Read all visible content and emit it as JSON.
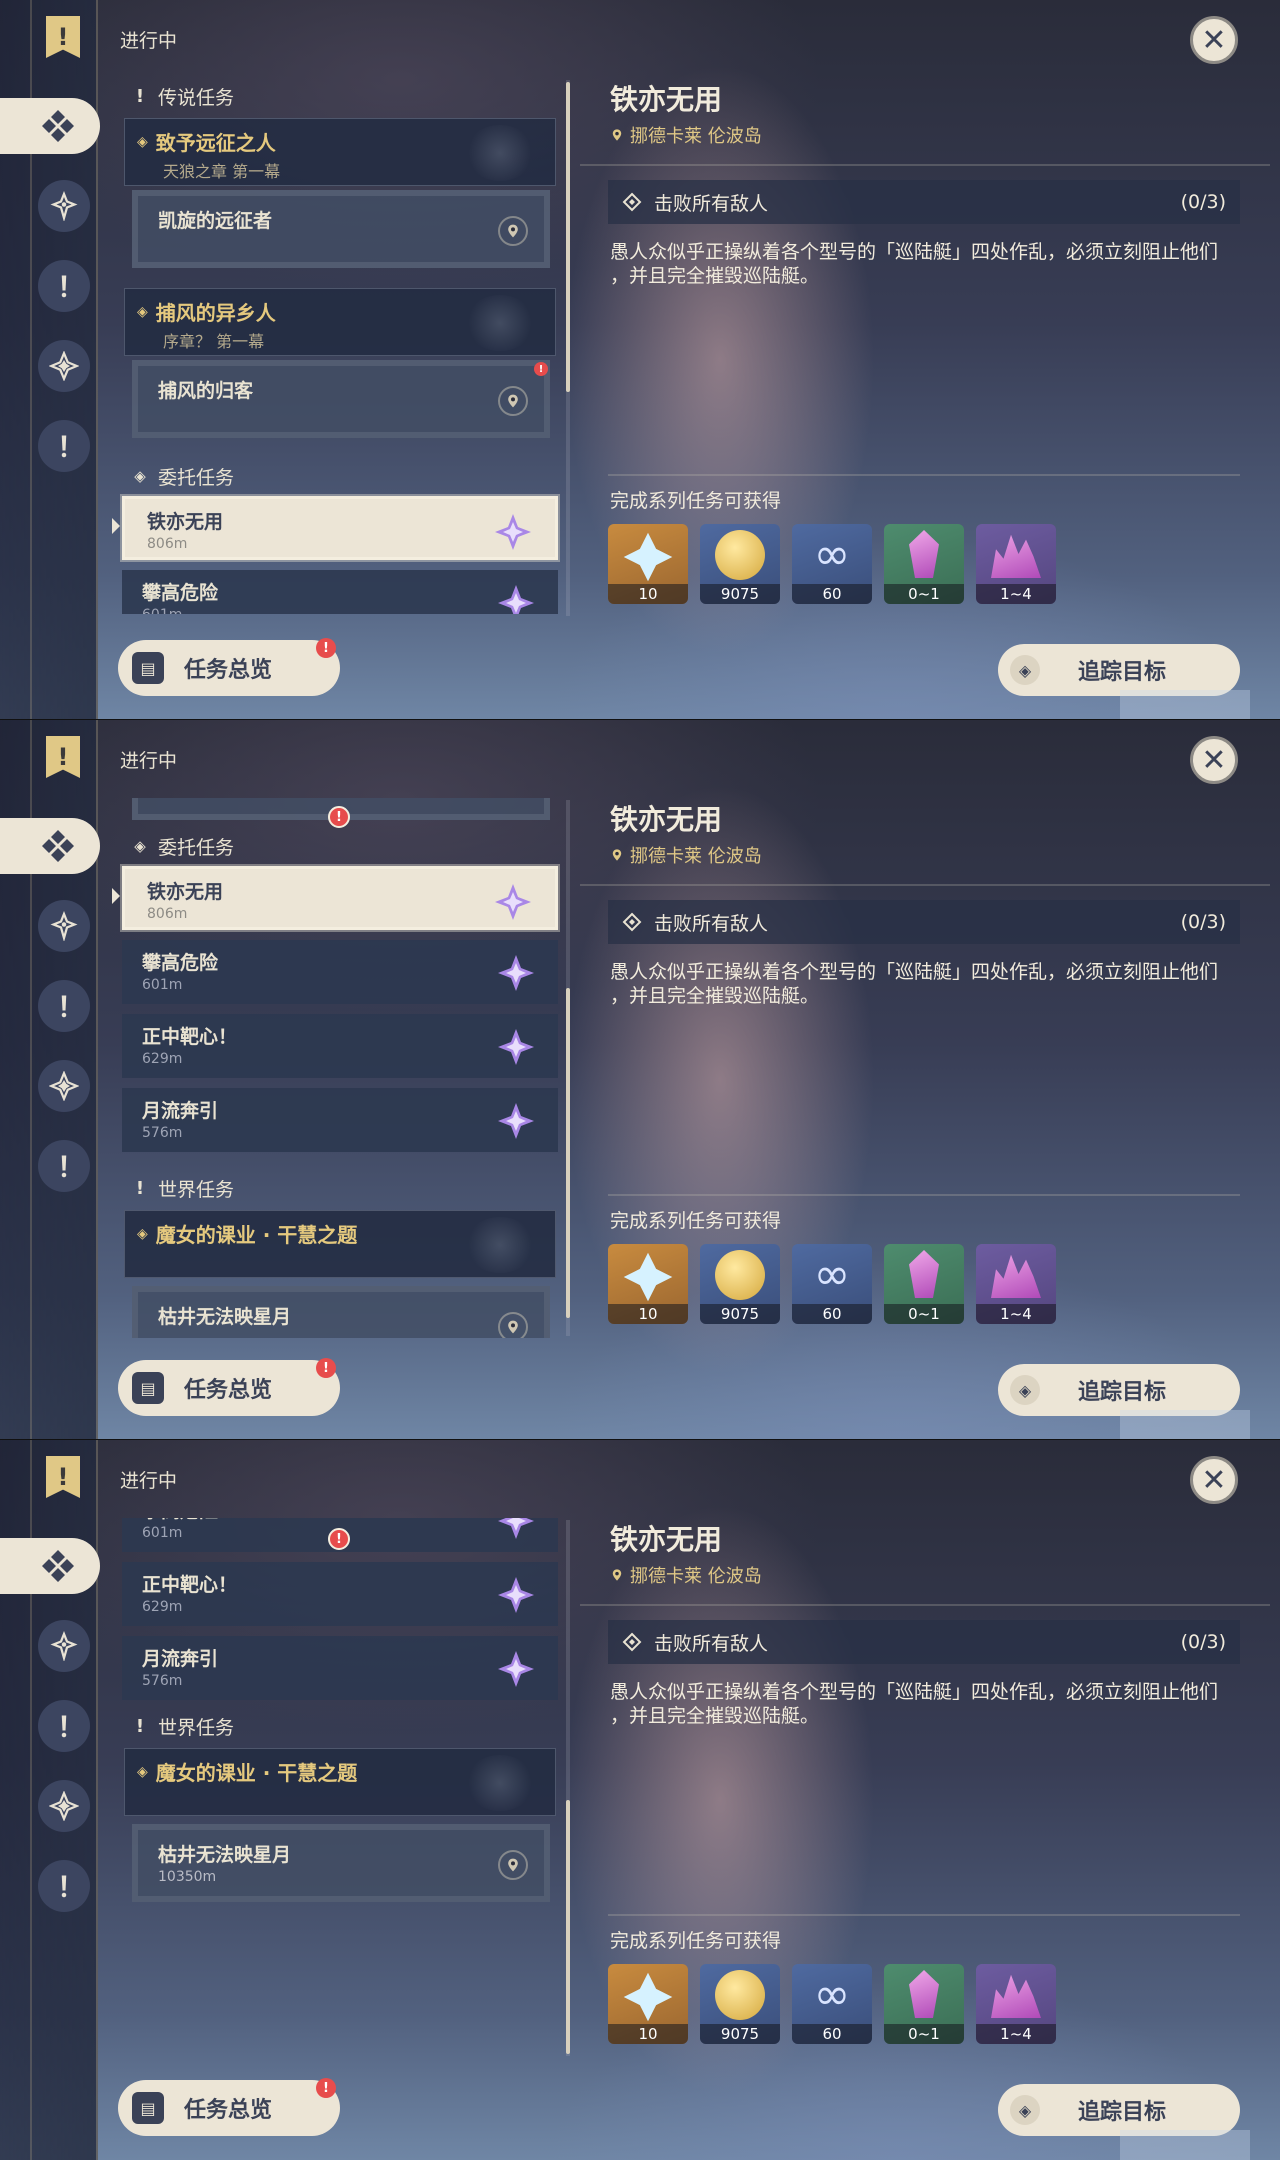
{
  "status_label": "进行中",
  "sections": {
    "legend": "传说任务",
    "commission": "委托任务",
    "world": "世界任务"
  },
  "legend_quests": [
    {
      "title": "致予远征之人",
      "subtitle": "天狼之章 第一幕",
      "subquest": "凯旋的远征者"
    },
    {
      "title": "捕风的异乡人",
      "subtitle": "序章？ 第一幕",
      "subquest": "捕风的归客"
    }
  ],
  "commissions": [
    {
      "name": "铁亦无用",
      "distance": "806m"
    },
    {
      "name": "攀高危险",
      "distance": "601m"
    },
    {
      "name": "正中靶心！",
      "distance": "629m"
    },
    {
      "name": "月流奔引",
      "distance": "576m"
    }
  ],
  "world_quest": {
    "title": "魔女的课业 · 干慧之题",
    "subquest": "枯井无法映星月",
    "distance": "10350m"
  },
  "buttons": {
    "overview": "任务总览",
    "track": "追踪目标",
    "alert_glyph": "!"
  },
  "detail": {
    "title": "铁亦无用",
    "location": "挪德卡莱 伦波岛",
    "objective": "击败所有敌人",
    "progress": "(0/3)",
    "description_line1": "愚人众似乎正操纵着各个型号的「巡陆艇」四处作乱，必须立刻阻止他们",
    "description_line2": "，并且完全摧毁巡陆艇。",
    "rewards_title": "完成系列任务可获得",
    "rewards": [
      {
        "icon": "primogem-icon",
        "count": "10"
      },
      {
        "icon": "mora-icon",
        "count": "9075"
      },
      {
        "icon": "companionship-exp-icon",
        "count": "60"
      },
      {
        "icon": "crystal-chunk-icon",
        "count": "0~1"
      },
      {
        "icon": "crystal-cluster-icon",
        "count": "1~4"
      }
    ]
  },
  "colors": {
    "accent_gold": "#e0c886",
    "panel_cream": "#ece5d6",
    "alert_red": "#e74c4c",
    "commission_star": "#a987e6"
  }
}
